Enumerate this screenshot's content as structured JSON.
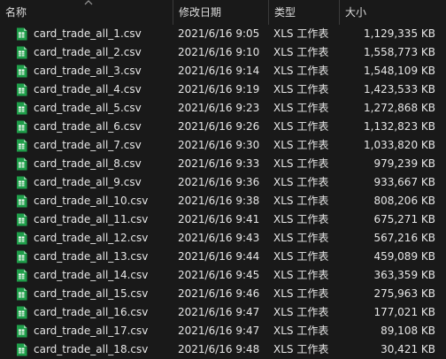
{
  "columns": {
    "name": "名称",
    "date": "修改日期",
    "type": "类型",
    "size": "大小"
  },
  "icons": {
    "file": "excel-csv-file-icon",
    "sort": "sort-up-chevron-icon"
  },
  "colors": {
    "background": "#191919",
    "icon_green": "#1f9e4a",
    "divider": "#3a3a3a"
  },
  "files": [
    {
      "name": "card_trade_all_1.csv",
      "date": "2021/6/16 9:05",
      "type": "XLS 工作表",
      "size": "1,129,335 KB"
    },
    {
      "name": "card_trade_all_2.csv",
      "date": "2021/6/16 9:10",
      "type": "XLS 工作表",
      "size": "1,558,773 KB"
    },
    {
      "name": "card_trade_all_3.csv",
      "date": "2021/6/16 9:14",
      "type": "XLS 工作表",
      "size": "1,548,109 KB"
    },
    {
      "name": "card_trade_all_4.csv",
      "date": "2021/6/16 9:19",
      "type": "XLS 工作表",
      "size": "1,423,533 KB"
    },
    {
      "name": "card_trade_all_5.csv",
      "date": "2021/6/16 9:23",
      "type": "XLS 工作表",
      "size": "1,272,868 KB"
    },
    {
      "name": "card_trade_all_6.csv",
      "date": "2021/6/16 9:26",
      "type": "XLS 工作表",
      "size": "1,132,823 KB"
    },
    {
      "name": "card_trade_all_7.csv",
      "date": "2021/6/16 9:30",
      "type": "XLS 工作表",
      "size": "1,033,820 KB"
    },
    {
      "name": "card_trade_all_8.csv",
      "date": "2021/6/16 9:33",
      "type": "XLS 工作表",
      "size": "979,239 KB"
    },
    {
      "name": "card_trade_all_9.csv",
      "date": "2021/6/16 9:36",
      "type": "XLS 工作表",
      "size": "933,667 KB"
    },
    {
      "name": "card_trade_all_10.csv",
      "date": "2021/6/16 9:38",
      "type": "XLS 工作表",
      "size": "808,206 KB"
    },
    {
      "name": "card_trade_all_11.csv",
      "date": "2021/6/16 9:41",
      "type": "XLS 工作表",
      "size": "675,271 KB"
    },
    {
      "name": "card_trade_all_12.csv",
      "date": "2021/6/16 9:43",
      "type": "XLS 工作表",
      "size": "567,216 KB"
    },
    {
      "name": "card_trade_all_13.csv",
      "date": "2021/6/16 9:44",
      "type": "XLS 工作表",
      "size": "459,089 KB"
    },
    {
      "name": "card_trade_all_14.csv",
      "date": "2021/6/16 9:45",
      "type": "XLS 工作表",
      "size": "363,359 KB"
    },
    {
      "name": "card_trade_all_15.csv",
      "date": "2021/6/16 9:46",
      "type": "XLS 工作表",
      "size": "275,963 KB"
    },
    {
      "name": "card_trade_all_16.csv",
      "date": "2021/6/16 9:47",
      "type": "XLS 工作表",
      "size": "177,021 KB"
    },
    {
      "name": "card_trade_all_17.csv",
      "date": "2021/6/16 9:47",
      "type": "XLS 工作表",
      "size": "89,108 KB"
    },
    {
      "name": "card_trade_all_18.csv",
      "date": "2021/6/16 9:48",
      "type": "XLS 工作表",
      "size": "30,421 KB"
    }
  ]
}
